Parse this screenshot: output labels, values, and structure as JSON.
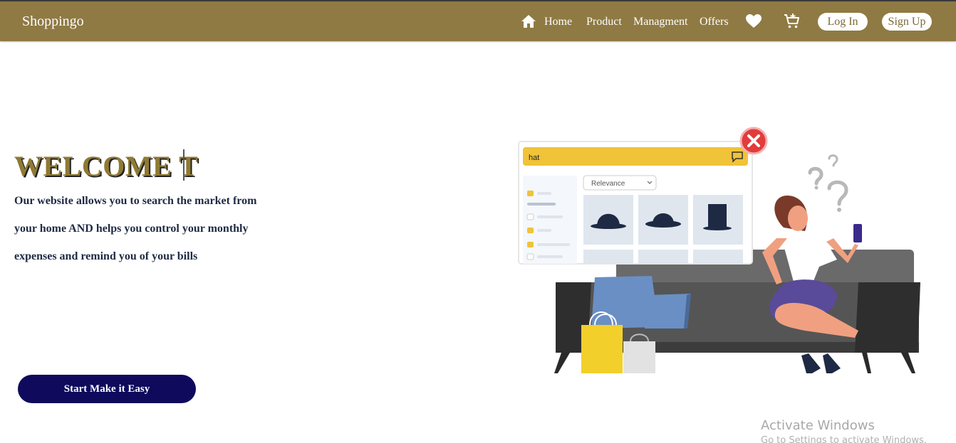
{
  "nav": {
    "brand": "Shoppingo",
    "home": "Home",
    "product": "Product",
    "management": "Managment",
    "offers": "Offers",
    "login": "Log In",
    "signup": "Sign Up"
  },
  "hero": {
    "title": "WELCOME T",
    "line1": "Our website allows you to search the market from",
    "line2": "your home AND helps you control your monthly",
    "line3": "expenses and remind you of your bills",
    "cta": "Start Make it Easy"
  },
  "illustration": {
    "search_text": "hat",
    "sort_label": "Relevance"
  },
  "system": {
    "watermark_title": "Activate Windows",
    "watermark_sub": "Go to Settings to activate Windows."
  },
  "colors": {
    "navbar": "#8f7a44",
    "cta": "#0f0a5c",
    "title": "#8f7a34"
  }
}
